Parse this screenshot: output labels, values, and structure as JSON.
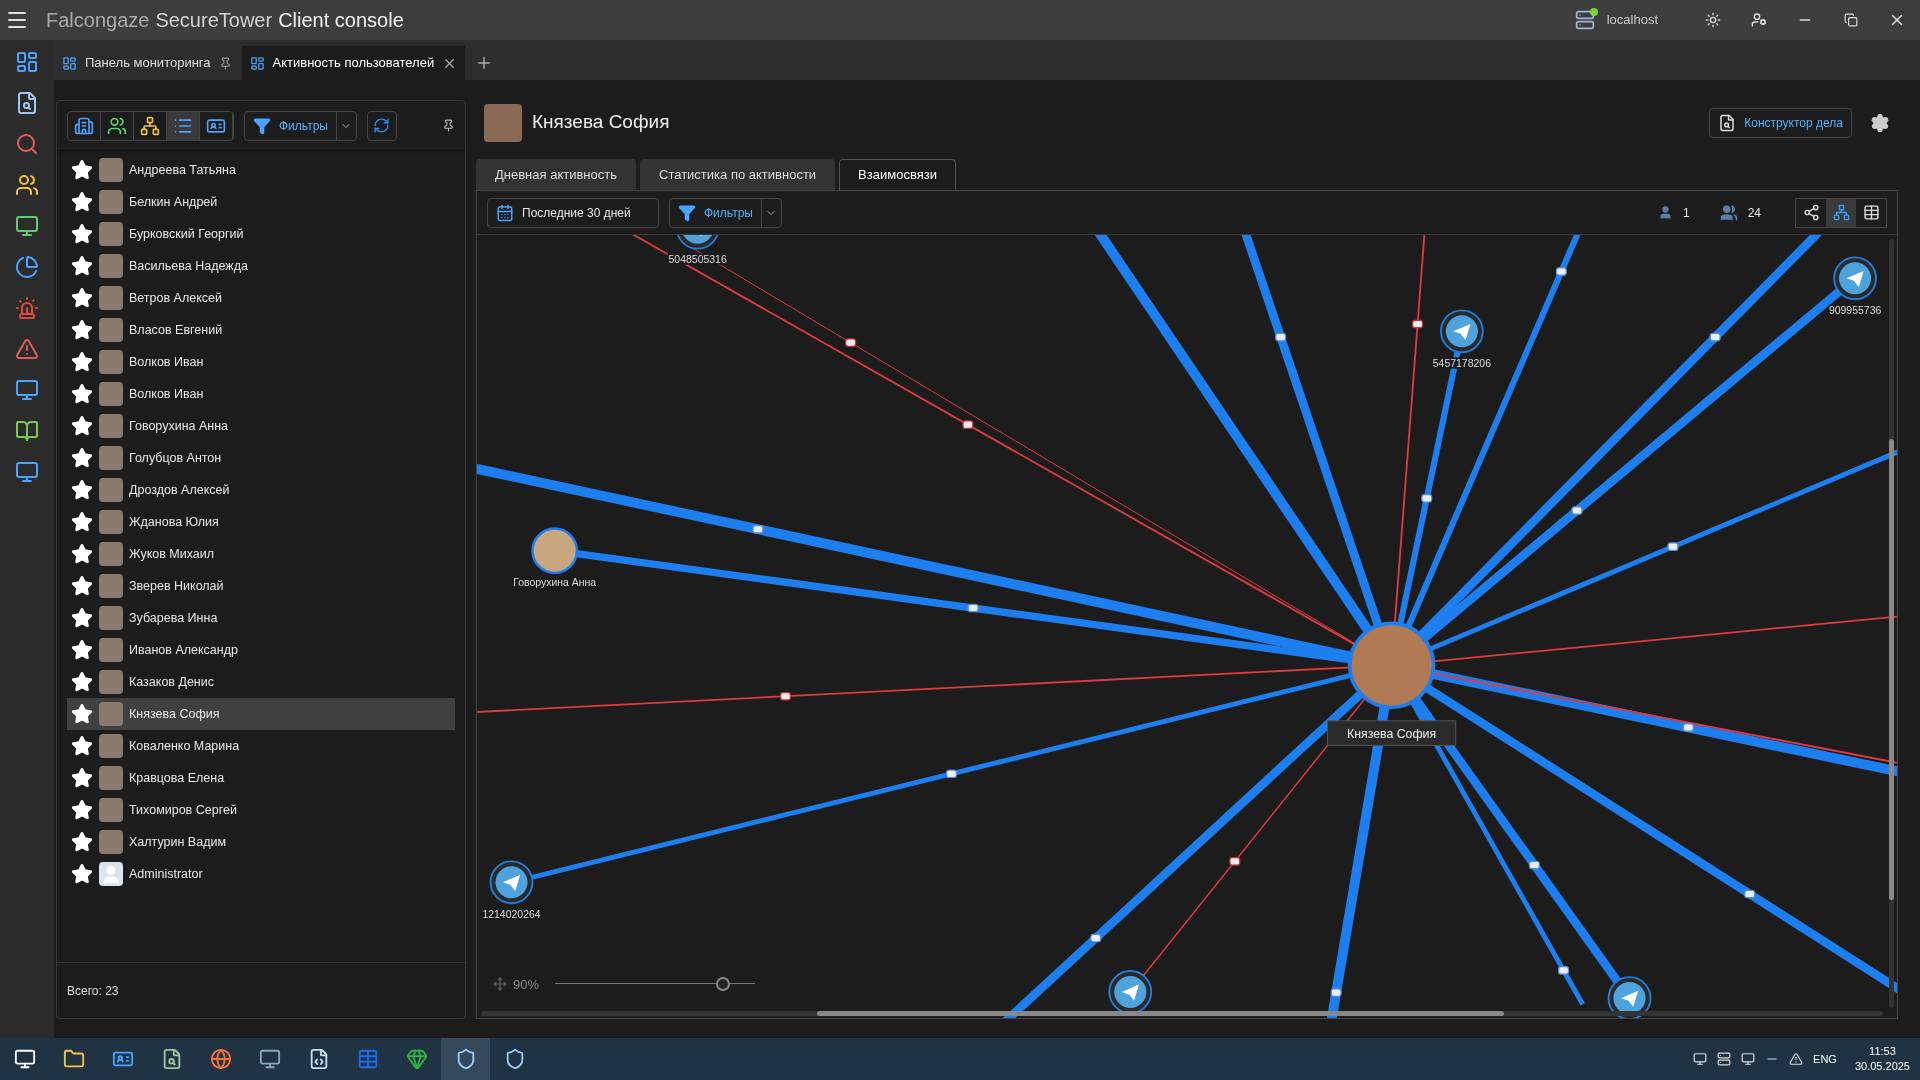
{
  "app": {
    "title_light": "Falcongaze",
    "title_mid": "SecureTower",
    "title_bold": "Client console",
    "server": "localhost"
  },
  "doc_tabs": [
    {
      "label": "Панель мониторинга",
      "selected": false,
      "pinned": true
    },
    {
      "label": "Активность пользователей",
      "selected": true,
      "pinned": false
    }
  ],
  "left_toolbar": {
    "views": [
      {
        "selected": false
      },
      {
        "selected": false
      },
      {
        "selected": false
      },
      {
        "selected": true
      },
      {
        "selected": false
      }
    ],
    "filter_label": "Фильтры"
  },
  "users": [
    {
      "name": "Андреева Татьяна",
      "selected": false,
      "kind": "photo"
    },
    {
      "name": "Белкин Андрей",
      "selected": false,
      "kind": "photo"
    },
    {
      "name": "Бурковский Георгий",
      "selected": false,
      "kind": "photo"
    },
    {
      "name": "Васильева Надежда",
      "selected": false,
      "kind": "photo"
    },
    {
      "name": "Ветров Алексей",
      "selected": false,
      "kind": "photo"
    },
    {
      "name": "Власов Евгений",
      "selected": false,
      "kind": "photo"
    },
    {
      "name": "Волков Иван",
      "selected": false,
      "kind": "photo"
    },
    {
      "name": "Волков Иван",
      "selected": false,
      "kind": "photo"
    },
    {
      "name": "Говорухина Анна",
      "selected": false,
      "kind": "photo"
    },
    {
      "name": "Голубцов Антон",
      "selected": false,
      "kind": "photo"
    },
    {
      "name": "Дроздов Алексей",
      "selected": false,
      "kind": "photo"
    },
    {
      "name": "Жданова Юлия",
      "selected": false,
      "kind": "photo"
    },
    {
      "name": "Жуков Михаил",
      "selected": false,
      "kind": "photo"
    },
    {
      "name": "Зверев Николай",
      "selected": false,
      "kind": "photo"
    },
    {
      "name": "Зубарева Инна",
      "selected": false,
      "kind": "photo"
    },
    {
      "name": "Иванов Александр",
      "selected": false,
      "kind": "photo"
    },
    {
      "name": "Казаков Денис",
      "selected": false,
      "kind": "photo"
    },
    {
      "name": "Князева София",
      "selected": true,
      "kind": "photo"
    },
    {
      "name": "Коваленко Марина",
      "selected": false,
      "kind": "photo"
    },
    {
      "name": "Кравцова Елена",
      "selected": false,
      "kind": "photo"
    },
    {
      "name": "Тихомиров Сергей",
      "selected": false,
      "kind": "photo"
    },
    {
      "name": "Халтурин Вадим",
      "selected": false,
      "kind": "photo"
    },
    {
      "name": "Administrator",
      "selected": false,
      "kind": "blank"
    }
  ],
  "total": "Всего: 23",
  "profile": {
    "name": "Князева София",
    "case_button": "Конструктор дела"
  },
  "tabs": [
    {
      "label": "Дневная активность",
      "selected": false
    },
    {
      "label": "Статистика по активности",
      "selected": false
    },
    {
      "label": "Взаимосвязи",
      "selected": true
    }
  ],
  "toolbar": {
    "period": "Последние 30 дней",
    "filter": "Фильтры",
    "users_count": "1",
    "groups_count": "24",
    "views": [
      {
        "selected": false
      },
      {
        "selected": true
      },
      {
        "selected": false
      }
    ]
  },
  "graph": {
    "center": "Князева София",
    "nodes": [
      {
        "kind": "telegram",
        "label": "5048505316"
      },
      {
        "kind": "telegram",
        "label": "5457178206"
      },
      {
        "kind": "telegram",
        "label": "909955736"
      },
      {
        "kind": "person",
        "label": "Говорухина Анна"
      },
      {
        "kind": "telegram",
        "label": "1214020264"
      },
      {
        "kind": "telegram"
      },
      {
        "kind": "telegram"
      }
    ],
    "zoom": "90%",
    "level": 0.84
  },
  "taskbar": {
    "lang": "ENG",
    "time": "11:53",
    "date": "30.05.2025"
  }
}
